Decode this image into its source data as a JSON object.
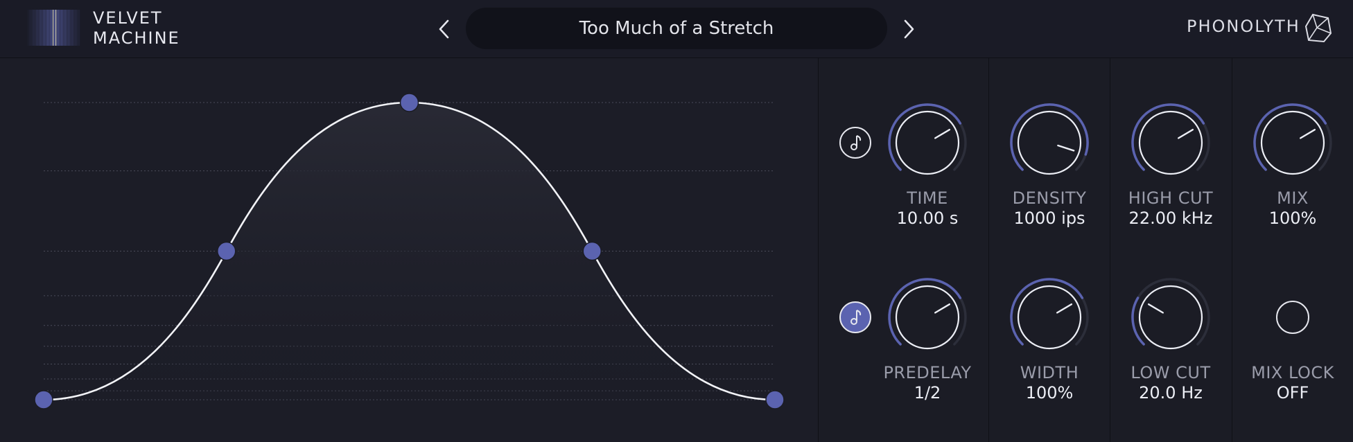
{
  "header": {
    "app_name_line1": "VELVET",
    "app_name_line2": "MACHINE",
    "preset_name": "Too Much of a Stretch",
    "brand": "PHONOLYTH",
    "prev_icon": "chevron-left-icon",
    "next_icon": "chevron-right-icon"
  },
  "envelope": {
    "points": [
      {
        "t": 0.0,
        "level": 0.0
      },
      {
        "t": 0.25,
        "level": 0.5
      },
      {
        "t": 0.5,
        "level": 1.0
      },
      {
        "t": 0.75,
        "level": 0.5
      },
      {
        "t": 1.0,
        "level": 0.0
      }
    ]
  },
  "params": {
    "time": {
      "label": "TIME",
      "value": "10.00 s",
      "level": 0.72
    },
    "density": {
      "label": "DENSITY",
      "value": "1000 ips",
      "level": 0.9
    },
    "high_cut": {
      "label": "HIGH CUT",
      "value": "22.00 kHz",
      "level": 0.72
    },
    "mix": {
      "label": "MIX",
      "value": "100%",
      "level": 0.72
    },
    "predelay": {
      "label": "PREDELAY",
      "value": "1/2",
      "level": 0.72
    },
    "width": {
      "label": "WIDTH",
      "value": "100%",
      "level": 0.72
    },
    "low_cut": {
      "label": "LOW CUT",
      "value": "20.0 Hz",
      "level": 0.28
    },
    "mix_lock": {
      "label": "MIX LOCK",
      "value": "OFF"
    }
  },
  "sync": {
    "time_sync_on": false,
    "predelay_sync_on": true,
    "icon": "music-note-icon"
  },
  "colors": {
    "accent": "#5b63b0",
    "background": "#1b1c25",
    "curve": "#f2f3f7"
  }
}
